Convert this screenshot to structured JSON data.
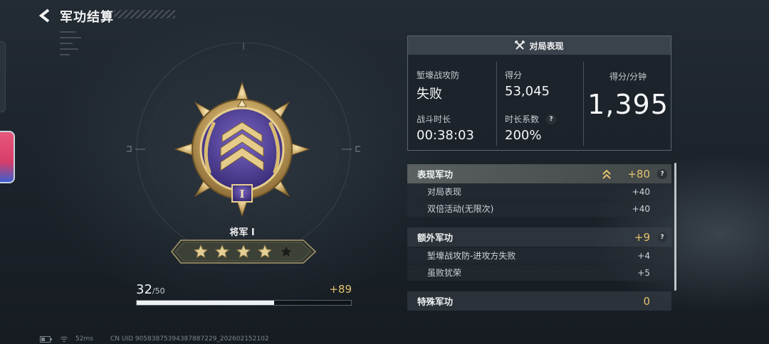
{
  "header": {
    "title": "军功结算"
  },
  "rank": {
    "name": "将军 Ⅰ",
    "medal_numeral": "I",
    "stars_filled": 4,
    "stars_total": 5
  },
  "progress": {
    "current": "32",
    "total": "/50",
    "fraction": 0.64,
    "gain": "+89"
  },
  "status_bar": {
    "latency": "52ms",
    "uid": "CN UID 9058387539438788722​9_202602152102"
  },
  "performance": {
    "header": "对局表现",
    "mode_label": "堑壕战攻防",
    "mode_result": "失败",
    "score_label": "得分",
    "score_value": "53,045",
    "spm_label": "得分/分钟",
    "spm_value": "1,395",
    "duration_label": "战斗时长",
    "duration_value": "00:38:03",
    "duration_factor_label": "时长系数",
    "duration_factor_value": "200%",
    "help_glyph": "?"
  },
  "merit": {
    "sections": [
      {
        "title": "表现军功",
        "total": "+80",
        "items": [
          {
            "label": "对局表现",
            "value": "+40"
          },
          {
            "label": "双倍活动(无限次)",
            "value": "+40"
          }
        ]
      },
      {
        "title": "额外军功",
        "total": "+9",
        "items": [
          {
            "label": "堑壕战攻防-进攻方失败",
            "value": "+4"
          },
          {
            "label": "虽败犹荣",
            "value": "+5"
          }
        ]
      },
      {
        "title": "特殊军功",
        "total": "0",
        "items": []
      }
    ]
  },
  "colors": {
    "gold": "#e4c46c",
    "accent_purple": "#4a3a8c",
    "panel_bg": "#1c232a"
  }
}
